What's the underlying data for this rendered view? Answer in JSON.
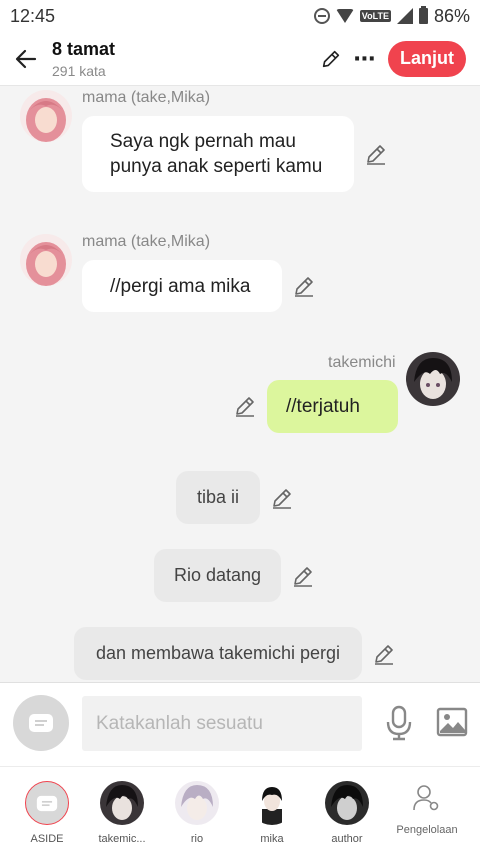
{
  "status": {
    "time": "12:45",
    "network_badge": "VoLTE",
    "battery": "86%"
  },
  "header": {
    "title": "8 tamat",
    "word_count": "291 kata",
    "next_label": "Lanjut"
  },
  "messages": [
    {
      "sender": "mama (take,Mika)",
      "text_line1": "Saya ngk pernah mau",
      "text_line2": "punya anak seperti kamu"
    },
    {
      "sender": "mama (take,Mika)",
      "text": "//pergi ama mika"
    },
    {
      "sender": "takemichi",
      "text": "//terjatuh"
    }
  ],
  "narrations": [
    "tiba ii",
    "Rio datang",
    "dan membawa takemichi pergi"
  ],
  "input": {
    "placeholder": "Katakanlah sesuatu"
  },
  "tray": {
    "characters": [
      "ASIDE",
      "takemic...",
      "rio",
      "mika",
      "author"
    ],
    "manage_label": "Pengelolaan"
  },
  "colors": {
    "accent": "#f0434e",
    "user_bubble": "#dcf69d",
    "narration_bubble": "#e9e9e9"
  },
  "icons": [
    "back-arrow-icon",
    "pencil-icon",
    "more-icon",
    "edit-icon",
    "aside-icon",
    "microphone-icon",
    "image-icon",
    "manage-person-icon"
  ]
}
